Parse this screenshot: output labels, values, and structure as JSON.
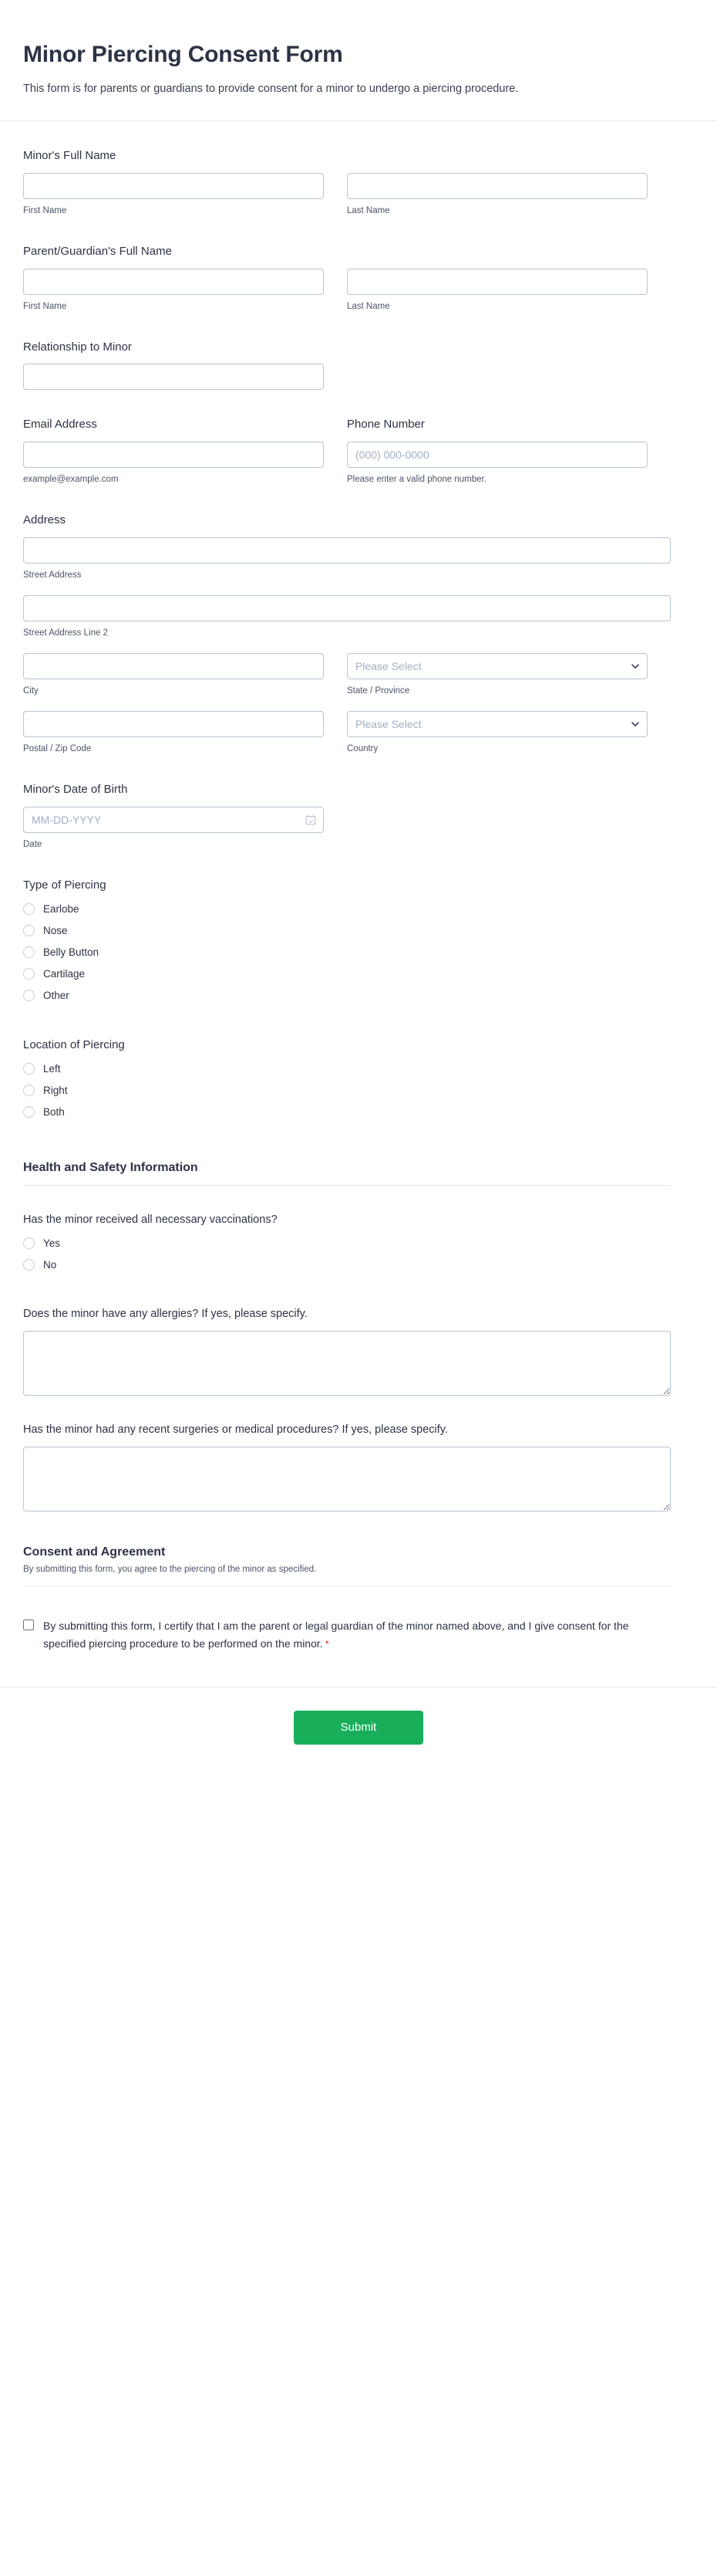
{
  "header": {
    "title": "Minor Piercing Consent Form",
    "subtitle": "This form is for parents or guardians to provide consent for a minor to undergo a piercing procedure."
  },
  "fields": {
    "minor_name": {
      "label": "Minor's Full Name",
      "first_sublabel": "First Name",
      "last_sublabel": "Last Name",
      "first_value": "",
      "last_value": ""
    },
    "guardian_name": {
      "label": "Parent/Guardian's Full Name",
      "first_sublabel": "First Name",
      "last_sublabel": "Last Name",
      "first_value": "",
      "last_value": ""
    },
    "relationship": {
      "label": "Relationship to Minor",
      "value": ""
    },
    "email": {
      "label": "Email Address",
      "value": "",
      "sublabel": "example@example.com"
    },
    "phone": {
      "label": "Phone Number",
      "value": "",
      "placeholder": "(000) 000-0000",
      "sublabel": "Please enter a valid phone number."
    },
    "address": {
      "label": "Address",
      "street_sublabel": "Street Address",
      "street_value": "",
      "street2_sublabel": "Street Address Line 2",
      "street2_value": "",
      "city_sublabel": "City",
      "city_value": "",
      "state_sublabel": "State / Province",
      "state_value": "Please Select",
      "postal_sublabel": "Postal / Zip Code",
      "postal_value": "",
      "country_sublabel": "Country",
      "country_value": "Please Select"
    },
    "dob": {
      "label": "Minor's Date of Birth",
      "value": "",
      "placeholder": "MM-DD-YYYY",
      "sublabel": "Date"
    },
    "piercing_type": {
      "label": "Type of Piercing",
      "options": [
        "Earlobe",
        "Nose",
        "Belly Button",
        "Cartilage",
        "Other"
      ]
    },
    "piercing_location": {
      "label": "Location of Piercing",
      "options": [
        "Left",
        "Right",
        "Both"
      ]
    }
  },
  "health_section": {
    "title": "Health and Safety Information",
    "vaccinations": {
      "label": "Has the minor received all necessary vaccinations?",
      "options": [
        "Yes",
        "No"
      ]
    },
    "allergies": {
      "label": "Does the minor have any allergies? If yes, please specify.",
      "value": ""
    },
    "surgeries": {
      "label": "Has the minor had any recent surgeries or medical procedures? If yes, please specify.",
      "value": ""
    }
  },
  "consent_section": {
    "title": "Consent and Agreement",
    "description": "By submitting this form, you agree to the piercing of the minor as specified.",
    "checkbox_text": "By submitting this form, I certify that I am the parent or legal guardian of the minor named above, and I give consent for the specified piercing procedure to be performed on the minor.",
    "required_marker": "*"
  },
  "footer": {
    "submit_label": "Submit"
  },
  "colors": {
    "submit_green": "#18ae5a",
    "required_red": "#e8281e",
    "border": "#b8c4d4",
    "text": "#2c3345"
  }
}
